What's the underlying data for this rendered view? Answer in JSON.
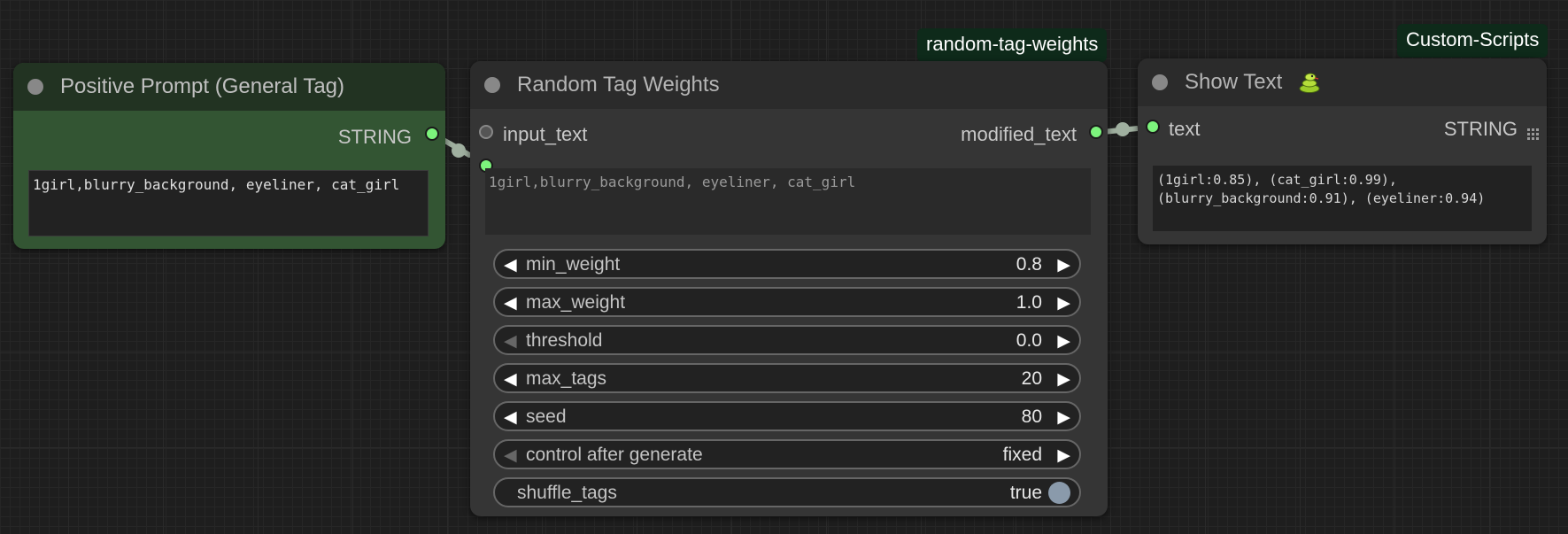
{
  "badges": {
    "rtw_badge": "random-tag-weights",
    "show_badge": "Custom-Scripts"
  },
  "positive_node": {
    "title": "Positive Prompt (General Tag)",
    "output_label": "STRING",
    "text": "1girl,blurry_background, eyeliner, cat_girl"
  },
  "rtw_node": {
    "title": "Random Tag Weights",
    "input_label": "input_text",
    "output_label": "modified_text",
    "input_preview": "1girl,blurry_background, eyeliner, cat_girl",
    "widgets": [
      {
        "label": "min_weight",
        "value": "0.8"
      },
      {
        "label": "max_weight",
        "value": "1.0"
      },
      {
        "label": "threshold",
        "value": "0.0"
      },
      {
        "label": "max_tags",
        "value": "20"
      },
      {
        "label": "seed",
        "value": "80"
      },
      {
        "label": "control after generate",
        "value": "fixed"
      },
      {
        "label": "shuffle_tags",
        "value": "true"
      }
    ]
  },
  "show_node": {
    "title": "Show Text",
    "input_label": "text",
    "output_label": "STRING",
    "output_text": "(1girl:0.85), (cat_girl:0.99),\n(blurry_background:0.91), (eyeliner:0.94)"
  },
  "icons": {
    "title_dot": "circle-icon",
    "snake": "snake-icon",
    "grid": "grid-icon"
  },
  "colors": {
    "slot_green": "#7cf37c",
    "positive_node_bg": "#335533",
    "node_bg": "#353535",
    "badge_bg": "#0e2a1a"
  }
}
